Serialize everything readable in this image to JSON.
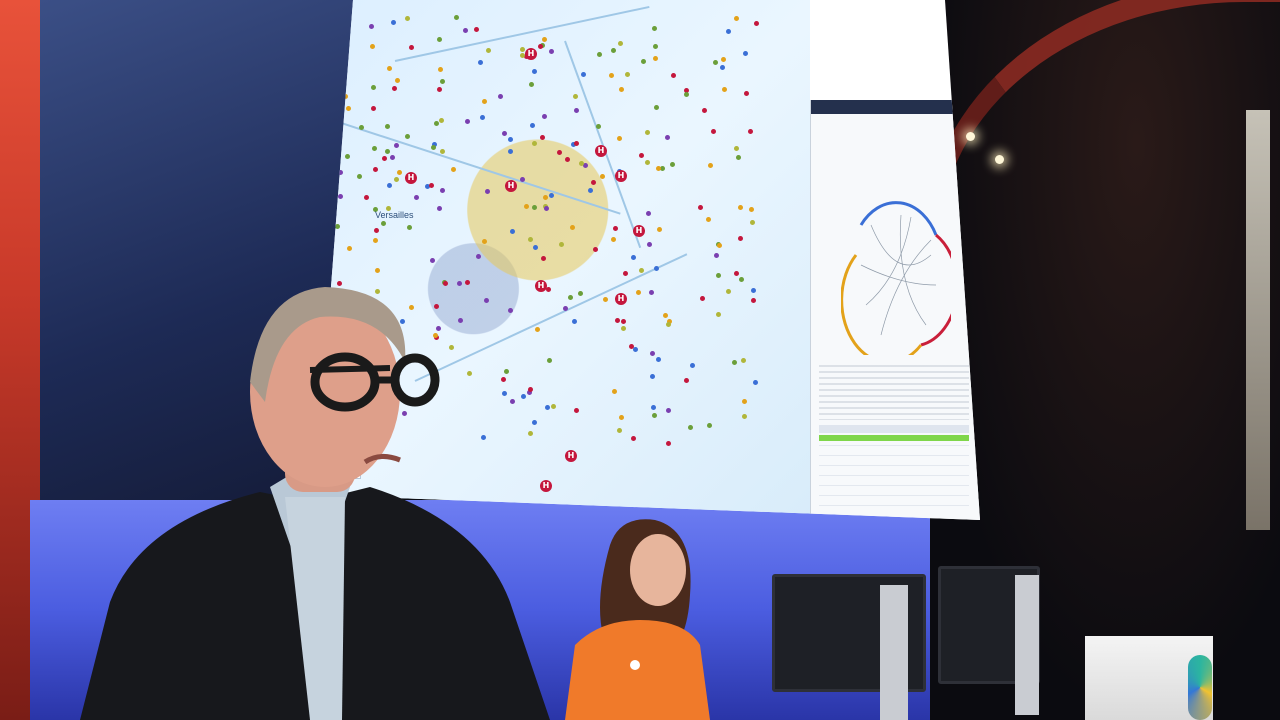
{
  "scene": {
    "screen_map": {
      "place_label": "Versailles",
      "corner_label": "Le"
    },
    "screen_panel": {
      "header_text": "",
      "chart_colors": [
        "#3a6fd6",
        "#c91f3a",
        "#e3a21a",
        "#8e9aa8"
      ]
    },
    "colors": {
      "map_marker": "#c4173d",
      "panel_header": "#24304d",
      "progress_green": "#7fd64a",
      "stage_blue": "#4b5de0",
      "shirt_orange": "#f07a2a"
    }
  }
}
